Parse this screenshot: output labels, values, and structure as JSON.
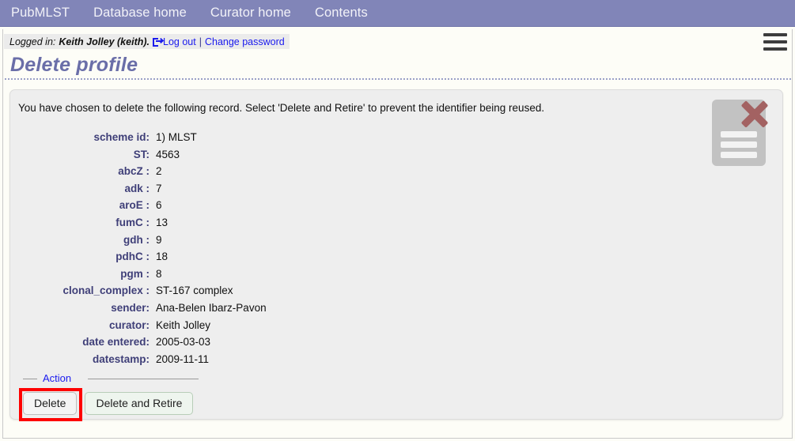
{
  "nav": {
    "items": [
      {
        "label": "PubMLST",
        "name": "nav-pubmlst"
      },
      {
        "label": "Database home",
        "name": "nav-database-home"
      },
      {
        "label": "Curator home",
        "name": "nav-curator-home"
      },
      {
        "label": "Contents",
        "name": "nav-contents"
      }
    ]
  },
  "login": {
    "prefix": "Logged in:",
    "user": "Keith Jolley (keith).",
    "logout_label": "Log out",
    "separator": "|",
    "change_password_label": "Change password"
  },
  "menu": {
    "hamburger_icon": "hamburger-menu-icon"
  },
  "page": {
    "title": "Delete profile"
  },
  "content": {
    "intro": "You have chosen to delete the following record. Select 'Delete and Retire' to prevent the identifier being reused.",
    "icon": "document-delete-icon",
    "fields": [
      {
        "label": "scheme id:",
        "value": "1) MLST"
      },
      {
        "label": "ST:",
        "value": "4563"
      },
      {
        "label": "abcZ :",
        "value": "2"
      },
      {
        "label": "adk :",
        "value": "7"
      },
      {
        "label": "aroE :",
        "value": "6"
      },
      {
        "label": "fumC :",
        "value": "13"
      },
      {
        "label": "gdh :",
        "value": "9"
      },
      {
        "label": "pdhC :",
        "value": "18"
      },
      {
        "label": "pgm :",
        "value": "8"
      },
      {
        "label": "clonal_complex :",
        "value": "ST-167 complex"
      },
      {
        "label": "sender:",
        "value": "Ana-Belen Ibarz-Pavon"
      },
      {
        "label": "curator:",
        "value": "Keith Jolley"
      },
      {
        "label": "date entered:",
        "value": "2005-03-03"
      },
      {
        "label": "datestamp:",
        "value": "2009-11-11"
      }
    ]
  },
  "action": {
    "legend": "Action",
    "delete_label": "Delete",
    "delete_retire_label": "Delete and Retire"
  },
  "colors": {
    "navbar": "#8185b8",
    "title": "#6a6ea8",
    "label": "#3f3f78",
    "link": "#1a1aee",
    "panel": "#eeeeee",
    "highlight": "#fe0000",
    "xmark": "#a36262",
    "retire_button": "#eef5ee"
  }
}
